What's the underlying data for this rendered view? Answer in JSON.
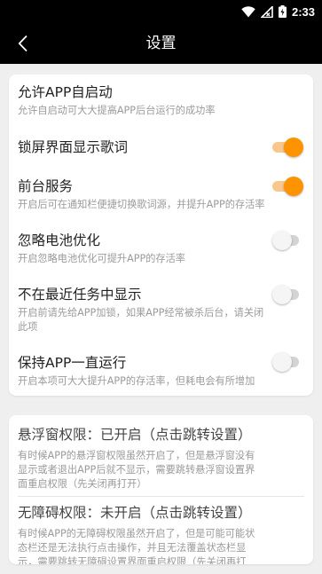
{
  "status_bar": {
    "time": "2:33",
    "icons": [
      "wifi-icon",
      "cellular-no-signal-icon",
      "battery-charging-icon"
    ]
  },
  "header": {
    "back_icon": "arrow-back-icon",
    "title": "设置"
  },
  "settings": [
    {
      "label": "允许APP自启动",
      "desc": "允许自启动可大大提高APP后台运行的成功率",
      "toggle": null
    },
    {
      "label": "锁屏界面显示歌词",
      "desc": "",
      "toggle": "on"
    },
    {
      "label": "前台服务",
      "desc": "开启后可在通知栏便捷切换歌词源，并提升APP的存活率",
      "toggle": "on"
    },
    {
      "label": "忽略电池优化",
      "desc": "开启忽略电池优化可提升APP的存活率",
      "toggle": "off"
    },
    {
      "label": "不在最近任务中显示",
      "desc_line1": "开启前请先给APP加锁，如果APP经常被杀后台，请关闭",
      "desc_line2": "此项",
      "toggle": "off"
    },
    {
      "label": "保持APP一直运行",
      "desc": "开启本项可大大提升APP的存活率，但耗电会有所增加",
      "toggle": "off"
    }
  ],
  "permissions": [
    {
      "label": "悬浮窗权限：已开启（点击跳转设置）",
      "desc_line1": "有时候APP的悬浮窗权限虽然开启了，但是悬浮窗没有",
      "desc_line2": "显示或者退出APP后就不显示，需要跳转悬浮窗设置界",
      "desc_line3": "面重启权限（先关闭再打开）"
    },
    {
      "label": "无障碍权限：未开启（点击跳转设置）",
      "desc_line1": "有时候APP的无障碍权限虽然开启了，但是可能可能状",
      "desc_line2": "态栏还是无法执行点击操作，并且无法覆盖状态栏显",
      "desc_line3": "示，需要跳转无障碍设置界面重启权限（先关闭再打"
    }
  ],
  "colors": {
    "accent": "#fe9300",
    "accent_track": "#f7c78d",
    "toolbar": "#000000",
    "background": "#efefef"
  }
}
